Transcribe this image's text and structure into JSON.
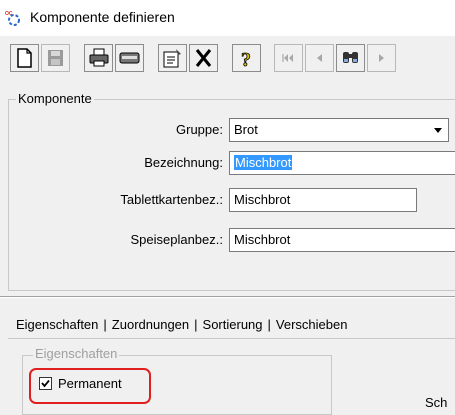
{
  "window": {
    "title": "Komponente definieren",
    "icon": "component-app-icon"
  },
  "toolbar": {
    "buttons": [
      {
        "name": "new-icon",
        "enabled": true
      },
      {
        "name": "save-icon",
        "enabled": false
      },
      {
        "name": "print-icon",
        "enabled": true
      },
      {
        "name": "print-preview-icon",
        "enabled": true
      },
      {
        "name": "properties-icon",
        "enabled": true
      },
      {
        "name": "delete-icon",
        "enabled": true
      },
      {
        "name": "help-icon",
        "enabled": true
      },
      {
        "name": "first-record-icon",
        "enabled": false
      },
      {
        "name": "previous-record-icon",
        "enabled": false
      },
      {
        "name": "search-icon",
        "enabled": true
      },
      {
        "name": "next-record-icon",
        "enabled": false
      }
    ]
  },
  "komponente": {
    "legend": "Komponente",
    "gruppe_label": "Gruppe:",
    "gruppe_value": "Brot",
    "bezeichnung_label": "Bezeichnung:",
    "bezeichnung_value": "Mischbrot",
    "tablettkarten_label": "Tablettkartenbez.:",
    "tablettkarten_value": "Mischbrot",
    "speiseplan_label": "Speiseplanbez.:",
    "speiseplan_value": "Mischbrot"
  },
  "tabs": [
    "Eigenschaften",
    "Zuordnungen",
    "Sortierung",
    "Verschieben"
  ],
  "eigenschaften": {
    "legend": "Eigenschaften",
    "permanent_label": "Permanent",
    "permanent_checked": true,
    "cut_off_text": "Sch"
  },
  "colors": {
    "selection": "#3399ff",
    "highlight": "#e02020",
    "help_icon": "#e0c000"
  }
}
